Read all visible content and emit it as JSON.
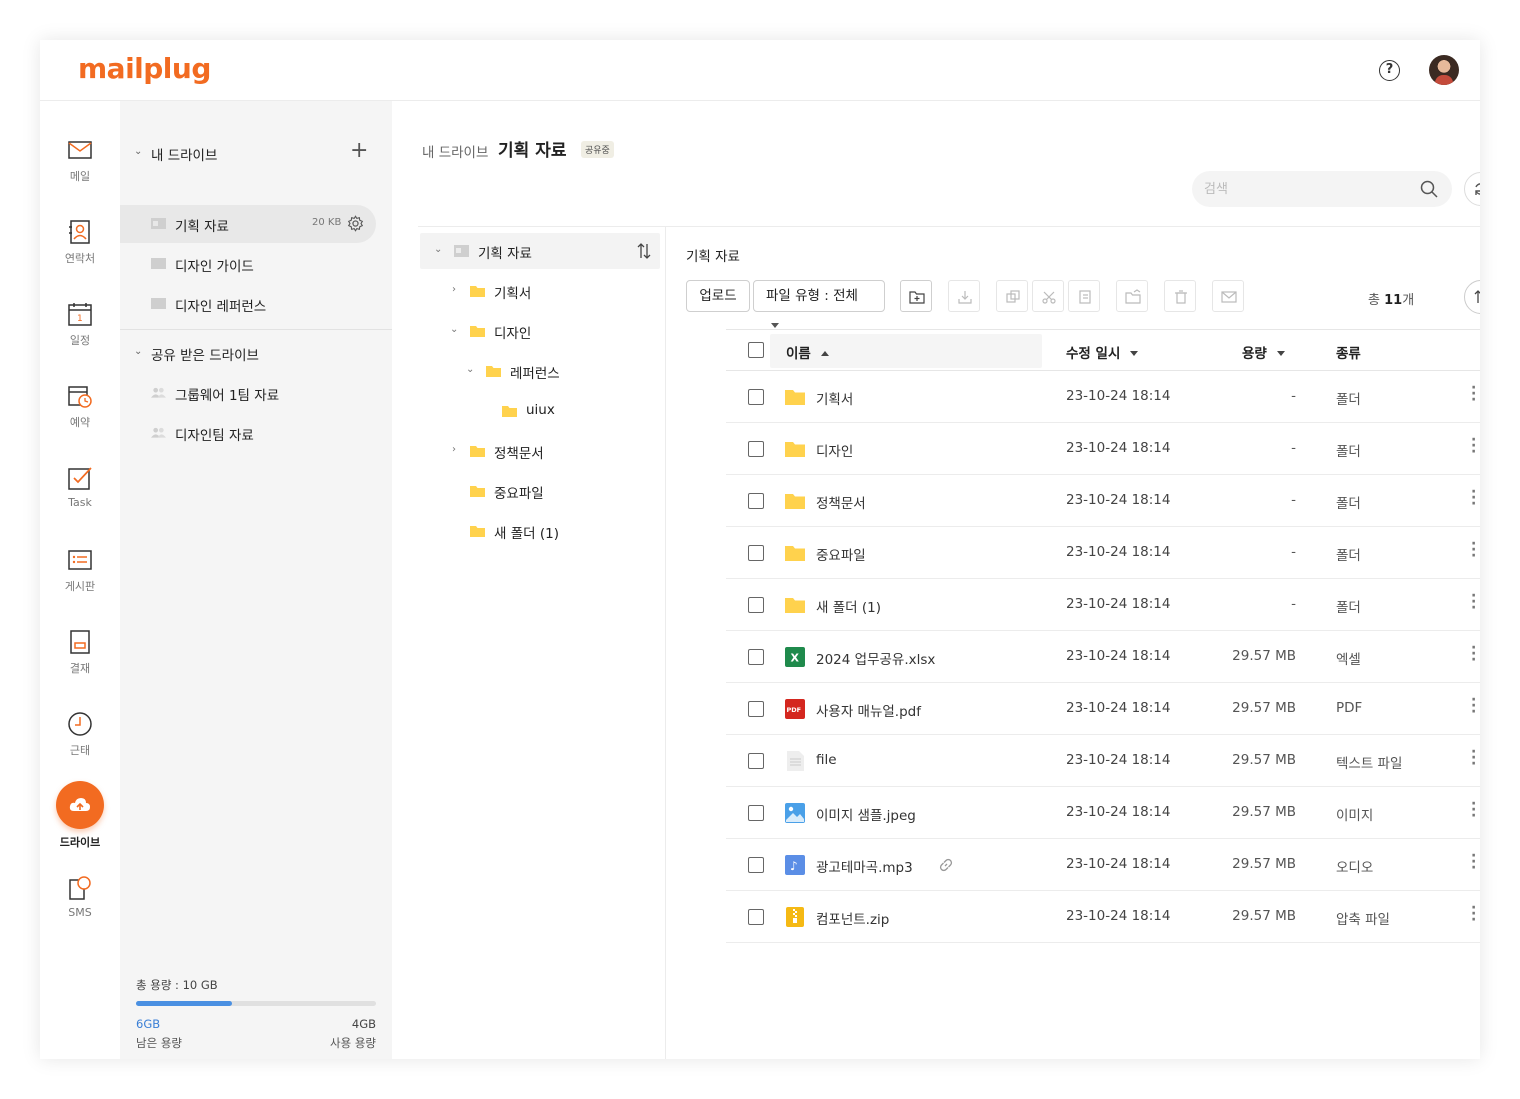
{
  "header": {
    "logo_text": "mailplug",
    "help_symbol": "?",
    "accent_color": "#f26b21"
  },
  "nav": {
    "items": [
      {
        "label": "메일",
        "icon": "mail-icon"
      },
      {
        "label": "연락처",
        "icon": "contacts-icon"
      },
      {
        "label": "일정",
        "icon": "calendar-icon"
      },
      {
        "label": "예약",
        "icon": "reservation-icon"
      },
      {
        "label": "Task",
        "icon": "task-icon"
      },
      {
        "label": "게시판",
        "icon": "board-icon"
      },
      {
        "label": "결재",
        "icon": "approval-icon"
      },
      {
        "label": "근태",
        "icon": "clock-icon"
      },
      {
        "label": "드라이브",
        "icon": "drive-cloud-icon",
        "active": true
      },
      {
        "label": "SMS",
        "icon": "sms-icon"
      }
    ]
  },
  "sidebar": {
    "my_drive_label": "내 드라이브",
    "add_symbol": "+",
    "my_drive_items": [
      {
        "label": "기획 자료",
        "size": "20 KB",
        "active": true
      },
      {
        "label": "디자인 가이드"
      },
      {
        "label": "디자인 레퍼런스"
      }
    ],
    "shared_drive_label": "공유 받은 드라이브",
    "shared_items": [
      {
        "label": "그룹웨어 1팀 자료"
      },
      {
        "label": "디자인팀 자료"
      }
    ],
    "storage": {
      "total_label": "총 용량 : 10 GB",
      "free_value": "6GB",
      "free_label": "남은 용량",
      "used_value": "4GB",
      "used_label": "사용 용량",
      "used_fraction": 0.4
    },
    "collapse_symbol": "«"
  },
  "main": {
    "breadcrumb_parent": "내 드라이브",
    "title": "기획 자료",
    "shared_badge": "공유중",
    "search_placeholder": "검색",
    "tree": {
      "root": "기획 자료",
      "nodes": [
        {
          "label": "기획서"
        },
        {
          "label": "디자인"
        },
        {
          "label": "레퍼런스"
        },
        {
          "label": "uiux"
        },
        {
          "label": "정책문서"
        },
        {
          "label": "중요파일"
        },
        {
          "label": "새 폴더 (1)"
        }
      ]
    },
    "panel_title": "기획 자료",
    "toolbar": {
      "upload_label": "업로드",
      "filter_label": "파일 유형 : 전체"
    },
    "total": {
      "prefix": "총 ",
      "count": "11",
      "suffix": "개"
    },
    "columns": {
      "name": "이름",
      "modified": "수정 일시",
      "size": "용량",
      "type": "종류"
    },
    "files": [
      {
        "name": "기획서",
        "date": "23-10-24 18:14",
        "size": "-",
        "type": "폴더",
        "icon": "folder"
      },
      {
        "name": "디자인",
        "date": "23-10-24 18:14",
        "size": "-",
        "type": "폴더",
        "icon": "folder"
      },
      {
        "name": "정책문서",
        "date": "23-10-24 18:14",
        "size": "-",
        "type": "폴더",
        "icon": "folder"
      },
      {
        "name": "중요파일",
        "date": "23-10-24 18:14",
        "size": "-",
        "type": "폴더",
        "icon": "folder"
      },
      {
        "name": "새 폴더 (1)",
        "date": "23-10-24 18:14",
        "size": "-",
        "type": "폴더",
        "icon": "folder"
      },
      {
        "name": "2024 업무공유.xlsx",
        "date": "23-10-24 18:14",
        "size": "29.57 MB",
        "type": "엑셀",
        "icon": "excel"
      },
      {
        "name": "사용자 매뉴얼.pdf",
        "date": "23-10-24 18:14",
        "size": "29.57 MB",
        "type": "PDF",
        "icon": "pdf"
      },
      {
        "name": "file",
        "date": "23-10-24 18:14",
        "size": "29.57 MB",
        "type": "텍스트 파일",
        "icon": "text"
      },
      {
        "name": "이미지 샘플.jpeg",
        "date": "23-10-24 18:14",
        "size": "29.57 MB",
        "type": "이미지",
        "icon": "image"
      },
      {
        "name": "광고테마곡.mp3",
        "date": "23-10-24 18:14",
        "size": "29.57 MB",
        "type": "오디오",
        "icon": "audio",
        "linked": true
      },
      {
        "name": "컴포넌트.zip",
        "date": "23-10-24 18:14",
        "size": "29.57 MB",
        "type": "압축 파일",
        "icon": "zip"
      }
    ],
    "excel_glyph": "X",
    "pdf_glyph": "PDF",
    "audio_glyph": "♪"
  }
}
